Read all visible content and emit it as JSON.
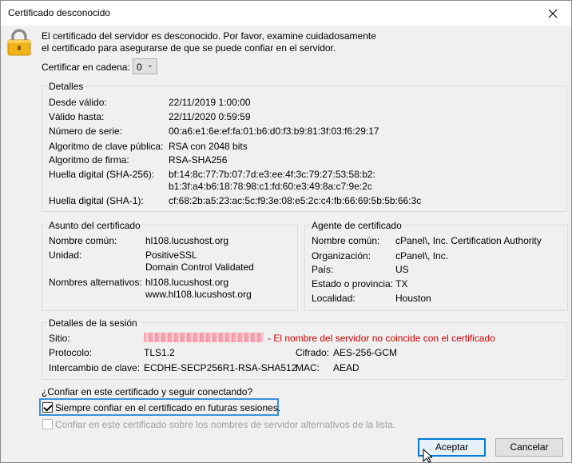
{
  "window": {
    "title": "Certificado desconocido"
  },
  "intro": {
    "line1": "El certificado del servidor es desconocido. Por favor, examine cuidadosamente",
    "line2": "el certificado para asegurarse de que se puede confiar en el servidor."
  },
  "chain": {
    "label": "Certificar en cadena:",
    "value": "0"
  },
  "details": {
    "legend": "Detalles",
    "rows": [
      {
        "label": "Desde válido:",
        "value": "22/11/2019 1:00:00"
      },
      {
        "label": "Válido hasta:",
        "value": "22/11/2020 0:59:59"
      },
      {
        "label": "Número de serie:",
        "value": "00:a6:e1:6e:ef:fa:01:b6:d0:f3:b9:81:3f:03:f6:29:17"
      },
      {
        "label": "Algoritmo de clave pública:",
        "value": "RSA con 2048 bits"
      },
      {
        "label": "Algoritmo de firma:",
        "value": "RSA-SHA256"
      },
      {
        "label": "Huella digital (SHA-256):",
        "value": "bf:14:8c:77:7b:07:7d:e3:ee:4f:3c:79:27:53:58:b2:",
        "value2": "b1:3f:a4:b6:18:78:98:c1:fd:60:e3:49:8a:c7:9e:2c"
      },
      {
        "label": "Huella digital (SHA-1):",
        "value": "cf:68:2b:a5:23:ac:5c:f9:3e:08:e5:2c:c4:fb:66:69:5b:5b:66:3c"
      }
    ]
  },
  "subject": {
    "legend": "Asunto del certificado",
    "common_name_label": "Nombre común:",
    "common_name": "hl108.lucushost.org",
    "unit_label": "Unidad:",
    "unit1": "PositiveSSL",
    "unit2": "Domain Control Validated",
    "alt_label": "Nombres alternativos:",
    "alt1": "hl108.lucushost.org",
    "alt2": "www.hl108.lucushost.org"
  },
  "issuer": {
    "legend": "Agente de certificado",
    "rows": [
      {
        "label": "Nombre común:",
        "value": "cPanel\\, Inc. Certification Authority"
      },
      {
        "label": "Organización:",
        "value": "cPanel\\, Inc."
      },
      {
        "label": "País:",
        "value": "US"
      },
      {
        "label": "Estado o provincia:",
        "value": "TX"
      },
      {
        "label": "Localidad:",
        "value": "Houston"
      }
    ]
  },
  "session": {
    "legend": "Detalles de la sesión",
    "site_label": "Sitio:",
    "site_warning": "- El nombre del servidor no coincide con el certificado",
    "protocol_label": "Protocolo:",
    "protocol": "TLS1.2",
    "cipher_label": "Cifrado:",
    "cipher": "AES-256-GCM",
    "kex_label": "Intercambio de clave:",
    "kex": "ECDHE-SECP256R1-RSA-SHA512",
    "mac_label": "MAC:",
    "mac": "AEAD"
  },
  "trust": {
    "question": "¿Confiar en este certificado y seguir conectando?",
    "always_label": "Siempre confiar en el certificado en futuras sesiones.",
    "always_checked": true,
    "alt_names_label": "Confiar en este certificado sobre los nombres de servidor alternativos de la lista."
  },
  "buttons": {
    "ok": "Aceptar",
    "cancel": "Cancelar"
  },
  "colors": {
    "warning": "#d00000",
    "focus": "#3c8fd9",
    "lock": "#f2b319"
  }
}
